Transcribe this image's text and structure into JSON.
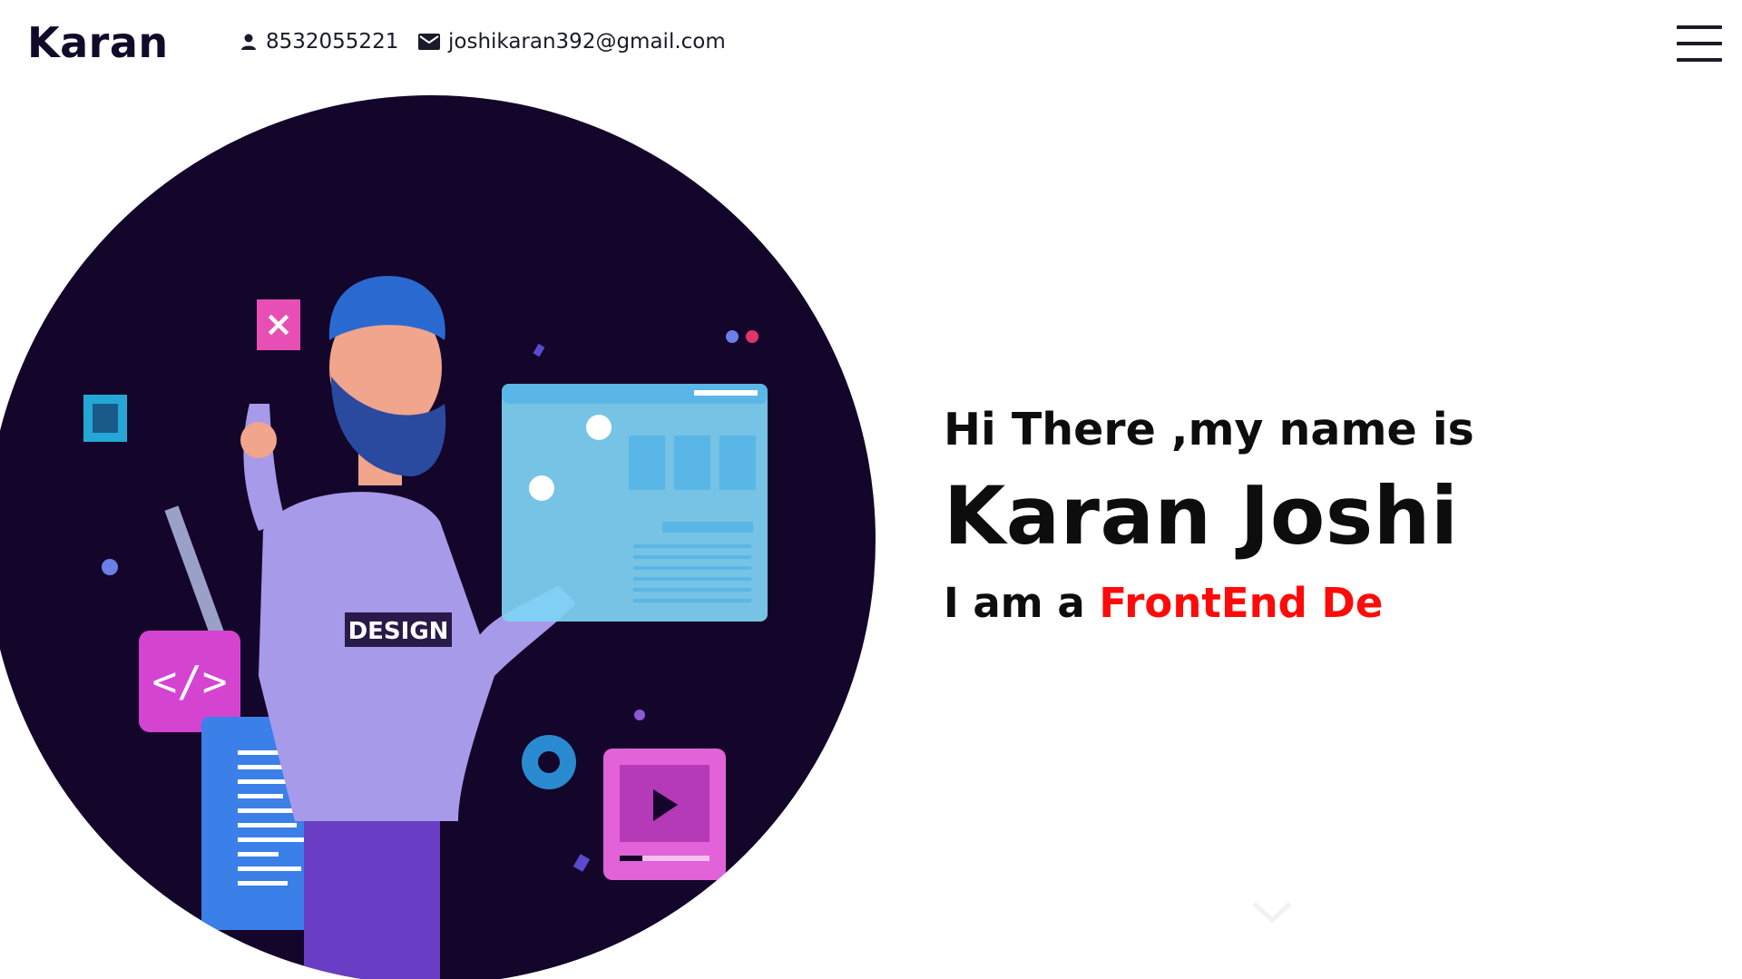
{
  "header": {
    "logo": "Karan",
    "phone": "8532055221",
    "email": "joshikaran392@gmail.com",
    "phone_icon": "person-icon",
    "email_icon": "mail-icon",
    "menu_icon": "hamburger-menu-icon"
  },
  "hero": {
    "illustration": "developer-illustration",
    "shirt_text": "DESIGN"
  },
  "intro": {
    "greeting": "Hi There ,my name is",
    "name": "Karan Joshi",
    "role_prefix": "I am a",
    "role_typed": "FrontEnd De"
  },
  "colors": {
    "accent": "#ff0a0a",
    "circle_bg": "#14052a",
    "text_dark": "#0d0d0d"
  }
}
